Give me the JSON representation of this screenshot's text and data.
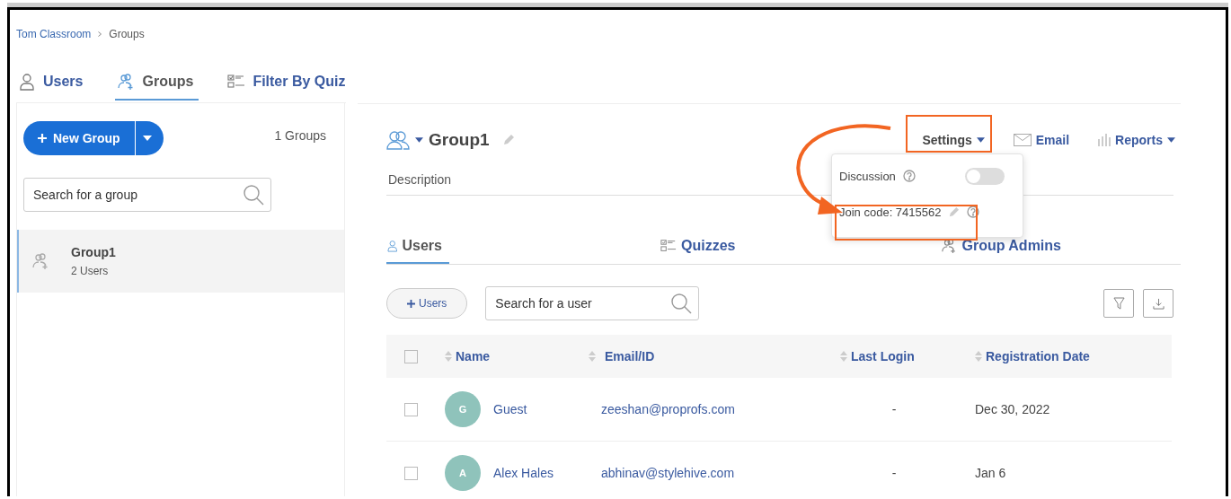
{
  "breadcrumb": [
    {
      "label": "Tom Classroom",
      "kind": "link"
    },
    {
      "label": "Groups",
      "kind": "current"
    }
  ],
  "top_tabs": [
    {
      "label": "Users",
      "selected": false
    },
    {
      "label": "Groups",
      "selected": true
    },
    {
      "label": "Filter By Quiz",
      "selected": false
    }
  ],
  "sidebar": {
    "new_group_button": "New Group",
    "count": "1 Groups",
    "search": {
      "placeholder": "Search for a group"
    },
    "groups": [
      {
        "name": "Group1",
        "meta": "2 Users",
        "selected": true
      }
    ]
  },
  "group": {
    "title": "Group1",
    "description": {
      "placeholder": "Description"
    },
    "actions": [
      {
        "label": "Settings",
        "kind": "settings"
      },
      {
        "label": "Email",
        "kind": "email"
      },
      {
        "label": "Reports",
        "kind": "reports"
      }
    ]
  },
  "settings_popup": {
    "discussion": {
      "label": "Discussion",
      "on": false
    },
    "join_code": "Join code: 7415562"
  },
  "sub_tabs": [
    {
      "label": "Users",
      "selected": true
    },
    {
      "label": "Quizzes",
      "selected": false
    },
    {
      "label": "Group Admins",
      "selected": false
    }
  ],
  "toolbar": {
    "add_users_button": "Users",
    "search": {
      "placeholder": "Search for a user"
    }
  },
  "table": {
    "select_all_checked": false,
    "columns": [
      "Name",
      "Email/ID",
      "Last Login",
      "Registration Date"
    ],
    "rows": [
      {
        "initial": "G",
        "name": "Guest",
        "email": "zeeshan@proprofs.com",
        "last_login": "-",
        "registration_date": "Dec 30, 2022",
        "checked": false
      },
      {
        "initial": "A",
        "name": "Alex Hales",
        "email": "abhinav@stylehive.com",
        "last_login": "-",
        "registration_date": "Jan 6",
        "checked": false
      }
    ]
  }
}
